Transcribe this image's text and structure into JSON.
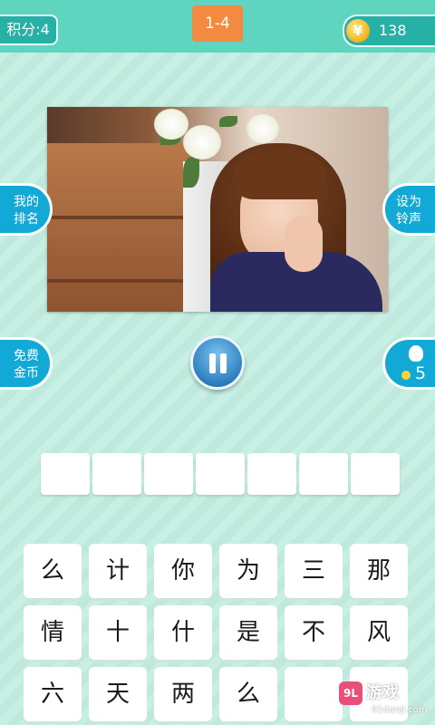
{
  "header": {
    "score_label": "积分:4",
    "level": "1-4",
    "coin_symbol": "¥",
    "coins": "138"
  },
  "side_buttons": {
    "my_rank": "我的\n排名",
    "set_ringtone": "设为\n铃声",
    "free_coins": "免费\n金币",
    "hint_count": "5"
  },
  "answer_slots": 7,
  "keyboard": {
    "rows": [
      [
        "么",
        "计",
        "你",
        "为",
        "三",
        "那"
      ],
      [
        "情",
        "十",
        "什",
        "是",
        "不",
        "风"
      ],
      [
        "六",
        "天",
        "两",
        "么",
        "",
        ""
      ]
    ]
  },
  "watermark": {
    "logo": "9L",
    "name": "游戏",
    "url": "91danji.com"
  },
  "colors": {
    "header": "#5fd4bf",
    "accent_blue": "#12a9d6",
    "level_badge": "#f28a3f"
  }
}
